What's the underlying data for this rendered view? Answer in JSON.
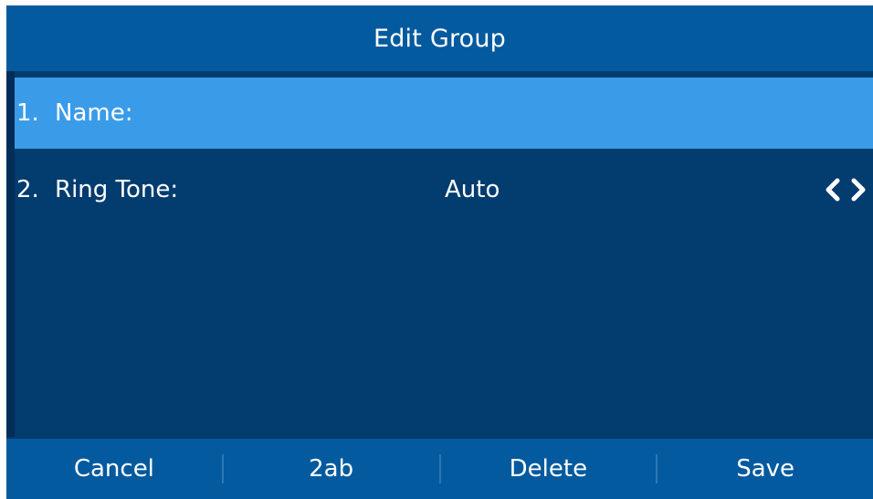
{
  "header": {
    "title": "Edit Group"
  },
  "items": [
    {
      "number": "1.",
      "label": "Name:",
      "value": "",
      "selected": true
    },
    {
      "number": "2.",
      "label": "Ring Tone:",
      "value": "Auto",
      "selected": false
    }
  ],
  "icons": {
    "left_arrow": "chevron-left-icon",
    "right_arrow": "chevron-right-icon"
  },
  "softkeys": [
    "Cancel",
    "2ab",
    "Delete",
    "Save"
  ],
  "colors": {
    "background": "#033c6e",
    "title_bar": "#045a9e",
    "selected_row": "#3a9ce8",
    "softkey_bar": "#045a9e",
    "text": "#ffffff"
  }
}
